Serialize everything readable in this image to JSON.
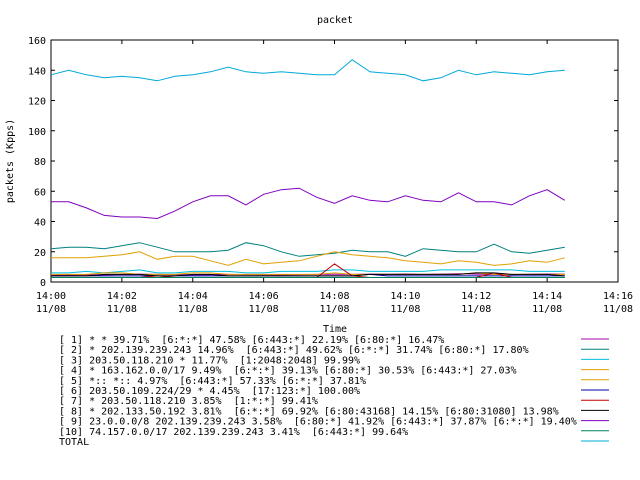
{
  "chart_data": {
    "type": "line",
    "title": "packet",
    "xlabel": "Time",
    "ylabel": "packets (Kpps)",
    "ylim": [
      0,
      160
    ],
    "yticks": [
      0,
      20,
      40,
      60,
      80,
      100,
      120,
      140,
      160
    ],
    "xlim": [
      "14:00",
      "14:16"
    ],
    "xticks": [
      {
        "time": "14:00",
        "date": "11/08"
      },
      {
        "time": "14:02",
        "date": "11/08"
      },
      {
        "time": "14:04",
        "date": "11/08"
      },
      {
        "time": "14:06",
        "date": "11/08"
      },
      {
        "time": "14:08",
        "date": "11/08"
      },
      {
        "time": "14:10",
        "date": "11/08"
      },
      {
        "time": "14:12",
        "date": "11/08"
      },
      {
        "time": "14:14",
        "date": "11/08"
      },
      {
        "time": "14:16",
        "date": "11/08"
      }
    ],
    "grid": false,
    "legend_position": "bottom",
    "x": [
      "14:00:00",
      "14:00:30",
      "14:01:00",
      "14:01:30",
      "14:02:00",
      "14:02:30",
      "14:03:00",
      "14:03:30",
      "14:04:00",
      "14:04:30",
      "14:05:00",
      "14:05:30",
      "14:06:00",
      "14:06:30",
      "14:07:00",
      "14:07:30",
      "14:08:00",
      "14:08:30",
      "14:09:00",
      "14:09:30",
      "14:10:00",
      "14:10:30",
      "14:11:00",
      "14:11:30",
      "14:12:00",
      "14:12:30",
      "14:13:00",
      "14:13:30",
      "14:14:00",
      "14:14:30"
    ],
    "series": [
      {
        "name": "[ 1] * * 39.71%  [6:*:*] 47.58% [6:443:*] 22.19% [6:80:*] 16.47%",
        "color": "#aa00aa",
        "values": [
          4.5,
          4.6,
          4.8,
          4.7,
          5.0,
          5.2,
          5.0,
          4.9,
          4.7,
          4.8,
          5.0,
          4.9,
          4.8,
          4.7,
          4.9,
          5.0,
          5.1,
          5.0,
          5.2,
          5.1,
          5.3,
          5.0,
          5.2,
          5.4,
          5.2,
          5.0,
          4.9,
          5.1,
          5.3,
          5.2
        ]
      },
      {
        "name": "[ 2] * 202.139.239.243 14.96%  [6:443:*] 49.62% [6:*:*] 31.74% [6:80:*] 17.80%",
        "color": "#008080",
        "values": [
          22,
          23,
          23,
          22,
          24,
          26,
          23,
          20,
          20,
          20,
          21,
          26,
          24,
          20,
          17,
          18,
          19,
          21,
          20,
          20,
          17,
          22,
          21,
          20,
          20,
          25,
          20,
          19,
          21,
          23
        ]
      },
      {
        "name": "[ 3] 203.50.118.210 * 11.77%  [1:2048:2048] 99.99%",
        "color": "#00c0e0",
        "values": [
          6,
          6,
          7,
          6,
          7,
          8,
          6,
          6,
          7,
          7,
          7,
          6,
          6,
          7,
          7,
          7,
          8,
          8,
          7,
          7,
          7,
          7,
          8,
          8,
          8,
          8,
          8,
          7,
          7,
          7
        ]
      },
      {
        "name": "[ 4] * 163.162.0.0/17 9.49%  [6:*:*] 39.13% [6:80:*] 30.53% [6:443:*] 27.03%",
        "color": "#e0a000",
        "values": [
          16,
          16,
          16,
          17,
          18,
          20,
          15,
          17,
          17,
          14,
          11,
          15,
          12,
          13,
          14,
          17,
          20,
          18,
          17,
          16,
          14,
          13,
          12,
          14,
          13,
          11,
          12,
          14,
          13,
          16
        ]
      },
      {
        "name": "[ 5] *:: *:: 4.97%  [6:443:*] 57.33% [6:*:*] 37.81%",
        "color": "#e0a000",
        "values": [
          5,
          5,
          5,
          6,
          6,
          5,
          5,
          5,
          6,
          6,
          5,
          5,
          5,
          5,
          5,
          5,
          6,
          5,
          5,
          5,
          5,
          5,
          5,
          5,
          6,
          5,
          5,
          5,
          5,
          5
        ]
      },
      {
        "name": "[ 6] 203.50.109.224/29 * 4.45%  [17:123:*] 100.00%",
        "color": "#0000a0",
        "values": [
          4,
          4,
          4,
          4,
          4,
          4,
          4,
          4,
          4,
          4,
          4,
          4,
          4,
          4,
          4,
          4,
          4,
          4,
          5,
          4,
          4,
          4,
          4,
          4,
          4,
          4,
          4,
          4,
          4,
          4
        ]
      },
      {
        "name": "[ 7] * 203.50.118.210 3.85%  [1:*:*] 99.41%",
        "color": "#c00000",
        "values": [
          3,
          3,
          3,
          3,
          3,
          3,
          4,
          3,
          3,
          3,
          3,
          3,
          3,
          3,
          3,
          3,
          12,
          4,
          3,
          3,
          3,
          3,
          3,
          3,
          3,
          6,
          3,
          3,
          3,
          3
        ]
      },
      {
        "name": "[ 8] * 202.133.50.192 3.81%  [6:*:*] 69.92% [6:80:43168] 14.15% [6:80:31080] 13.98%",
        "color": "#000000",
        "values": [
          4,
          4,
          4,
          5,
          5,
          5,
          4,
          4,
          5,
          5,
          4,
          4,
          4,
          4,
          4,
          4,
          4,
          4,
          5,
          5,
          5,
          5,
          5,
          5,
          6,
          6,
          5,
          5,
          5,
          4
        ]
      },
      {
        "name": "[ 9] 23.0.0.0/8 202.139.239.243 3.58%  [6:80:*] 41.92% [6:443:*] 37.87% [6:*:*] 19.40%",
        "color": "#8000c0",
        "values": [
          53,
          53,
          49,
          44,
          43,
          43,
          42,
          47,
          53,
          57,
          57,
          51,
          58,
          61,
          62,
          56,
          52,
          57,
          54,
          53,
          57,
          54,
          53,
          59,
          53,
          53,
          51,
          57,
          61,
          54
        ]
      },
      {
        "name": "[10] 74.157.0.0/17 202.139.239.243 3.41%  [6:443:*] 99.64%",
        "color": "#008060",
        "values": [
          3,
          3,
          3,
          3,
          3,
          3,
          3,
          3,
          3,
          3,
          3,
          3,
          3,
          3,
          3,
          3,
          3,
          3,
          3,
          3,
          3,
          3,
          3,
          3,
          3,
          3,
          3,
          3,
          3,
          3
        ]
      },
      {
        "name": "TOTAL",
        "color": "#00a8d8",
        "values": [
          137,
          140,
          137,
          135,
          136,
          135,
          133,
          136,
          137,
          139,
          142,
          139,
          138,
          139,
          138,
          137,
          137,
          147,
          139,
          138,
          137,
          133,
          135,
          140,
          137,
          139,
          138,
          137,
          139,
          140
        ]
      }
    ]
  }
}
